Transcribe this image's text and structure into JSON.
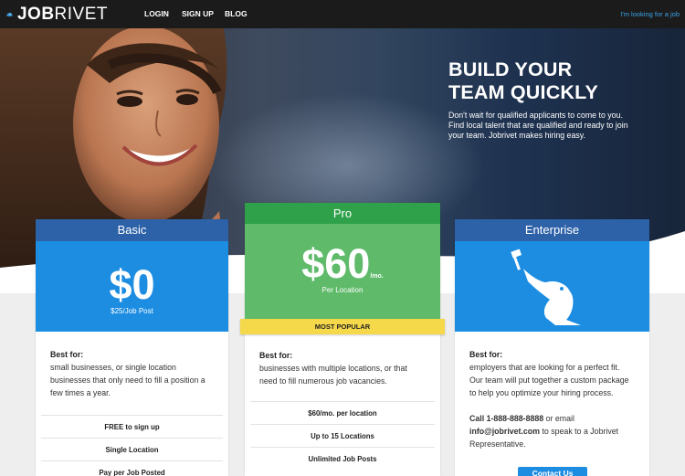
{
  "nav": {
    "logo_text_bold": "JOB",
    "logo_text_light": "RIVET",
    "links": [
      {
        "label": "LOGIN"
      },
      {
        "label": "SIGN UP"
      },
      {
        "label": "BLOG"
      }
    ],
    "right_link": "I'm looking for a job"
  },
  "hero": {
    "title_line1": "BUILD YOUR",
    "title_line2": "TEAM QUICKLY",
    "subtitle": "Don't wait for qualified applicants to come to you. Find local talent that are qualified and ready to join your team. Jobrivet makes hiring easy."
  },
  "plans": {
    "basic": {
      "name": "Basic",
      "price": "$0",
      "price_note": "$25/Job Post",
      "best_for_label": "Best for:",
      "best_for_text": "small businesses, or single location businesses that only need to fill a position a few times a year.",
      "features": [
        "FREE to sign up",
        "Single Location",
        "Pay per Job Posted"
      ]
    },
    "pro": {
      "name": "Pro",
      "price": "$60",
      "price_suffix": "/mo.",
      "price_note": "Per Location",
      "badge": "MOST POPULAR",
      "best_for_label": "Best for:",
      "best_for_text": "businesses with multiple locations, or that need to fill numerous job vacancies.",
      "features": [
        "$60/mo. per location",
        "Up to 15 Locations",
        "Unlimited Job Posts"
      ]
    },
    "enterprise": {
      "name": "Enterprise",
      "icon": "frog-icon",
      "best_for_label": "Best for:",
      "best_for_text": "employers that are looking for a perfect fit. Our team will put together a custom package to help you optimize your hiring process.",
      "call_label": "Call 1-888-888-8888",
      "call_mid": " or email ",
      "email": "info@jobrivet.com",
      "call_tail": " to speak to a Jobrivet Representative.",
      "button": "Contact Us"
    }
  },
  "colors": {
    "nav_bg": "#1b1b1b",
    "accent_blue": "#1d8de2",
    "header_blue": "#2e62a8",
    "pro_green": "#2fa14a",
    "pro_light_green": "#5fba6a",
    "badge_yellow": "#f6d94a"
  }
}
